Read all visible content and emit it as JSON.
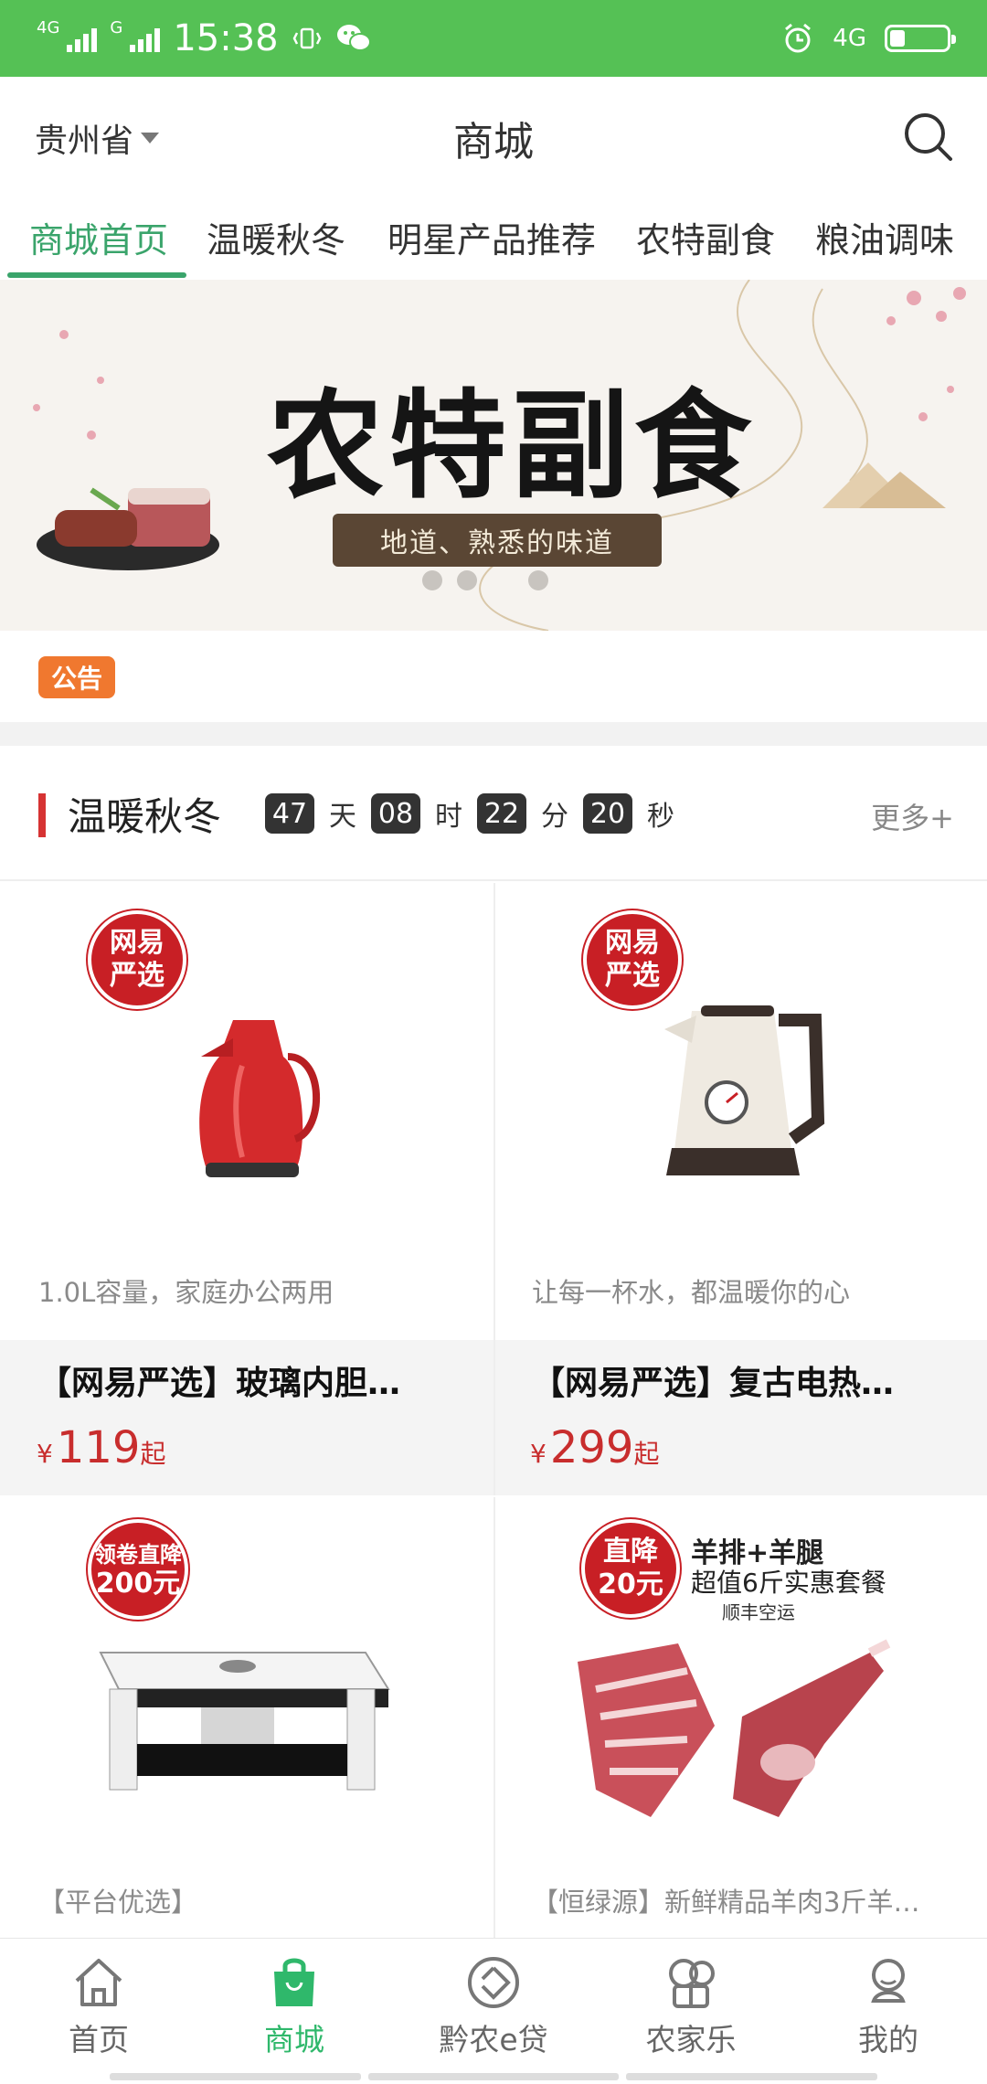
{
  "status": {
    "time": "15:38",
    "net1": "4G",
    "net2": "G",
    "net_right": "4G"
  },
  "header": {
    "location": "贵州省",
    "title": "商城"
  },
  "tabs": [
    {
      "label": "商城首页",
      "active": true
    },
    {
      "label": "温暖秋冬"
    },
    {
      "label": "明星产品推荐"
    },
    {
      "label": "农特副食"
    },
    {
      "label": "粮油调味"
    }
  ],
  "banner": {
    "title": "农特副食",
    "subtitle": "地道、熟悉的味道"
  },
  "notice": {
    "badge": "公告"
  },
  "section": {
    "title": "温暖秋冬",
    "countdown": {
      "days": "47",
      "hours": "08",
      "minutes": "22",
      "seconds": "20"
    },
    "units": {
      "day": "天",
      "hour": "时",
      "minute": "分",
      "second": "秒"
    },
    "more": "更多+"
  },
  "products": [
    {
      "desc": "1.0L容量，家庭办公两用",
      "name": "【网易严选】玻璃内胆…",
      "currency": "¥",
      "price": "119",
      "unit": "起",
      "badge_l1": "网易",
      "badge_l2": "严选"
    },
    {
      "desc": "让每一杯水，都温暖你的心",
      "name": "【网易严选】复古电热…",
      "currency": "¥",
      "price": "299",
      "unit": "起",
      "badge_l1": "网易",
      "badge_l2": "严选"
    },
    {
      "desc": "【平台优选】",
      "badge_l1": "领卷直降",
      "badge_l2": "200元"
    },
    {
      "desc": "【恒绿源】新鲜精品羊肉3斤羊…",
      "badge_l1": "直降",
      "badge_l2": "20元",
      "promo_l1": "羊排+羊腿",
      "promo_l2": "超值6斤实惠套餐",
      "promo_l3": "顺丰空运"
    }
  ],
  "nav": [
    {
      "label": "首页",
      "icon": "home-icon"
    },
    {
      "label": "商城",
      "icon": "shopping-bag-icon",
      "active": true
    },
    {
      "label": "黔农e贷",
      "icon": "loan-icon"
    },
    {
      "label": "农家乐",
      "icon": "farm-stay-icon"
    },
    {
      "label": "我的",
      "icon": "profile-icon"
    }
  ],
  "colors": {
    "status_green": "#55c155",
    "accent_green": "#3aa46b",
    "price_red": "#c82d2d",
    "notice_orange": "#f0782f"
  }
}
